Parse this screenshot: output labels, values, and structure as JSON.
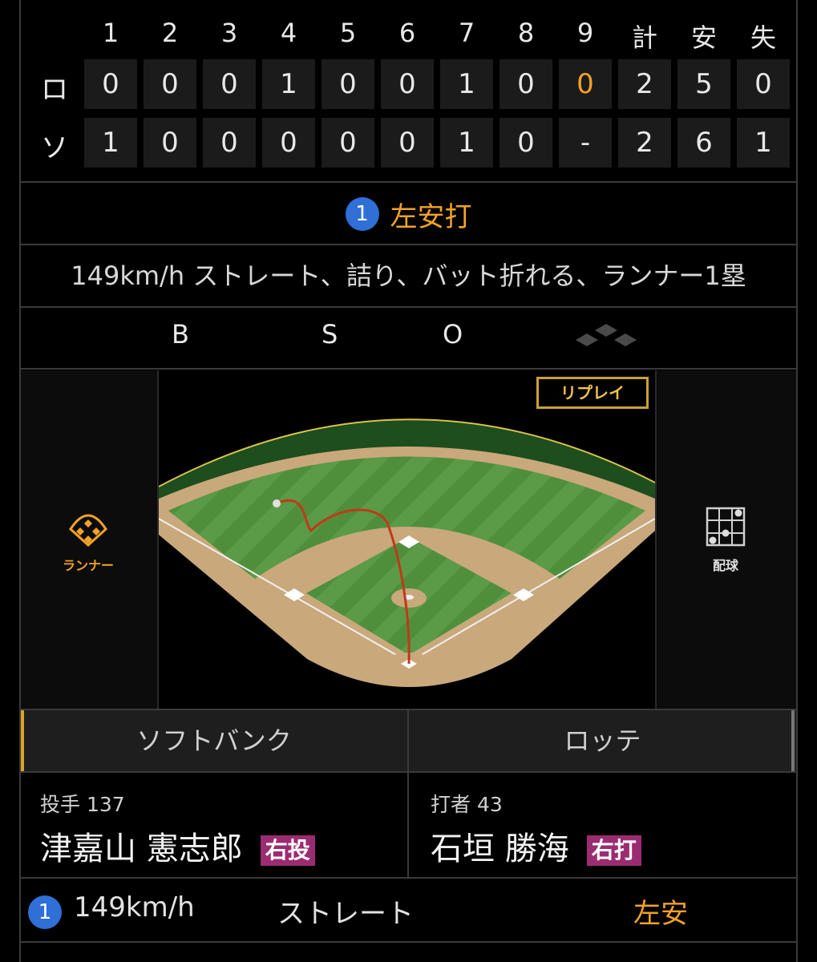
{
  "scoreboard": {
    "headers": [
      "1",
      "2",
      "3",
      "4",
      "5",
      "6",
      "7",
      "8",
      "9",
      "計",
      "安",
      "失"
    ],
    "rows": [
      {
        "team": "ロ",
        "cells": [
          "0",
          "0",
          "0",
          "1",
          "0",
          "0",
          "1",
          "0",
          "0",
          "2",
          "5",
          "0"
        ]
      },
      {
        "team": "ソ",
        "cells": [
          "1",
          "0",
          "0",
          "0",
          "0",
          "0",
          "1",
          "0",
          "-",
          "2",
          "6",
          "1"
        ]
      }
    ]
  },
  "play": {
    "number": "1",
    "title": "左安打",
    "description": "149km/h ストレート、詰り、バット折れる、ランナー1塁"
  },
  "count": {
    "b_label": "B",
    "s_label": "S",
    "o_label": "O"
  },
  "field": {
    "replay_label": "リプレイ",
    "runner_label": "ランナー",
    "pitch_label": "配球"
  },
  "tabs": [
    "ソフトバンク",
    "ロッテ"
  ],
  "pitcher": {
    "role": "投手 137",
    "name": "津嘉山 憲志郎",
    "hand": "右投"
  },
  "batter": {
    "role": "打者 43",
    "name": "石垣 勝海",
    "hand": "右打"
  },
  "pitch_log": [
    {
      "number": "1",
      "speed": "149km/h",
      "type": "ストレート",
      "result": "左安"
    }
  ],
  "colors": {
    "accent": "#f3a227",
    "blue": "#2f6fd6",
    "hand_badge": "#9b2c72",
    "grass": "#4f8f3c",
    "dirt": "#c9a87c"
  }
}
